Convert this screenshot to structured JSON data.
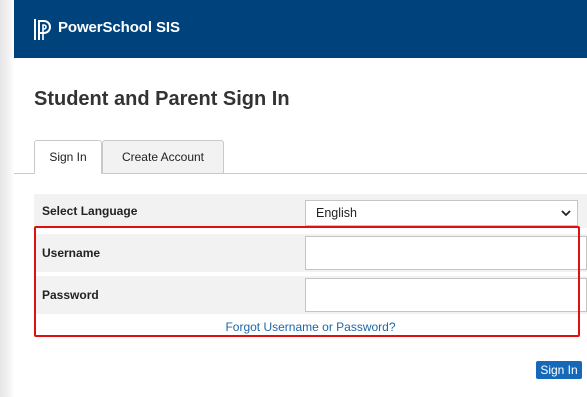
{
  "header": {
    "brand": "PowerSchool SIS",
    "logo_icon": "powerschool-p-logo",
    "background": "#00427c"
  },
  "page": {
    "title": "Student and Parent Sign In"
  },
  "tabs": [
    {
      "label": "Sign In",
      "active": true
    },
    {
      "label": "Create Account",
      "active": false
    }
  ],
  "form": {
    "language": {
      "label": "Select Language",
      "value": "English",
      "icon": "chevron-down-icon"
    },
    "username": {
      "label": "Username",
      "value": ""
    },
    "password": {
      "label": "Password",
      "value": ""
    },
    "forgot_link": "Forgot Username or Password?",
    "submit_label": "Sign In"
  },
  "colors": {
    "link": "#1f67a8",
    "button": "#1668b8",
    "highlight": "#e01010"
  }
}
